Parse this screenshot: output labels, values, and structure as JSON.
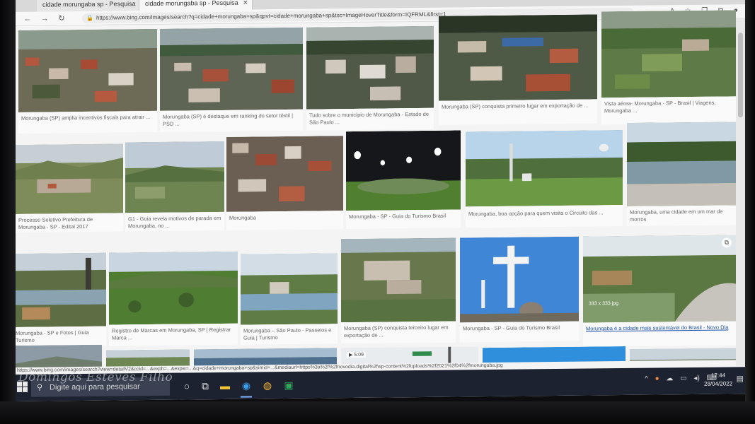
{
  "browser": {
    "tabs": [
      {
        "label": "cidade morungaba sp - Pesquisa",
        "active": false
      },
      {
        "label": "cidade morungaba sp - Pesquisa",
        "active": true
      }
    ],
    "address_url": "https://www.bing.com/images/search?q=cidade+morungaba+sp&qpvt=cidade+morungaba+sp&tsc=ImageHoverTitle&form=IQFRML&first=1",
    "status_url": "https://www.bing.com/images/search?view=detailV2&ccid=...&exph=...&expw=...&q=cidade+morungaba+sp&simid=...&mediaurl=https%3a%2f%2fnovodia.digital%2fwp-content%2fuploads%2f2021%2f04%2fmorungaba.jpg"
  },
  "results": [
    {
      "caption": "Morungaba (SP) amplia incentivos fiscais para atrair ..."
    },
    {
      "caption": "Morungaba (SP) é destaque em ranking do setor têxtil | PSD ..."
    },
    {
      "caption": "Tudo sobre o município de Morungaba - Estado de São Paulo ..."
    },
    {
      "caption": "Morungaba (SP) conquista primeiro lugar em exportação de ..."
    },
    {
      "caption": "Vista aérea- Morungaba - SP - Brasil | Viagens, Morungaba ..."
    },
    {
      "caption": "Processo Seletivo Prefeitura de Morungaba - SP - Edital 2017"
    },
    {
      "caption": "G1 - Guia revela motivos de parada em Morungaba, no ..."
    },
    {
      "caption": "Morungaba"
    },
    {
      "caption": "Morungaba - SP - Guia do Turismo Brasil"
    },
    {
      "caption": "Morungaba, boa opção para quem visita o Circuito das ..."
    },
    {
      "caption": "Morungaba, uma cidade em um mar de morros"
    },
    {
      "caption": "Morungaba - SP e Fotos | Guia Turismo"
    },
    {
      "caption": "Registro de Marcas em Morungaba, SP | Registrar Marca ..."
    },
    {
      "caption": "Morungaba – São Paulo - Passeios e Guia | Turismo"
    },
    {
      "caption": "Morungaba (SP) conquista terceiro lugar em exportação de ..."
    },
    {
      "caption": "Morungaba - SP - Guia do Turismo Brasil"
    },
    {
      "caption": "Morungaba é a cidade mais sustentável do Brasil - Novo Dia",
      "hover_label": "333 x 333 jpg"
    }
  ],
  "bottom_row_badges": {
    "r20": "▶ 5:09"
  },
  "taskbar": {
    "search_placeholder": "Digite aqui para pesquisar",
    "time": "17:44",
    "date": "28/04/2022"
  },
  "watermark": "Domingos Esteves Filho",
  "colors": {
    "taskbar": "#1c2230",
    "link": "#1a4fa8",
    "edge_active": "#7fb4ff"
  }
}
